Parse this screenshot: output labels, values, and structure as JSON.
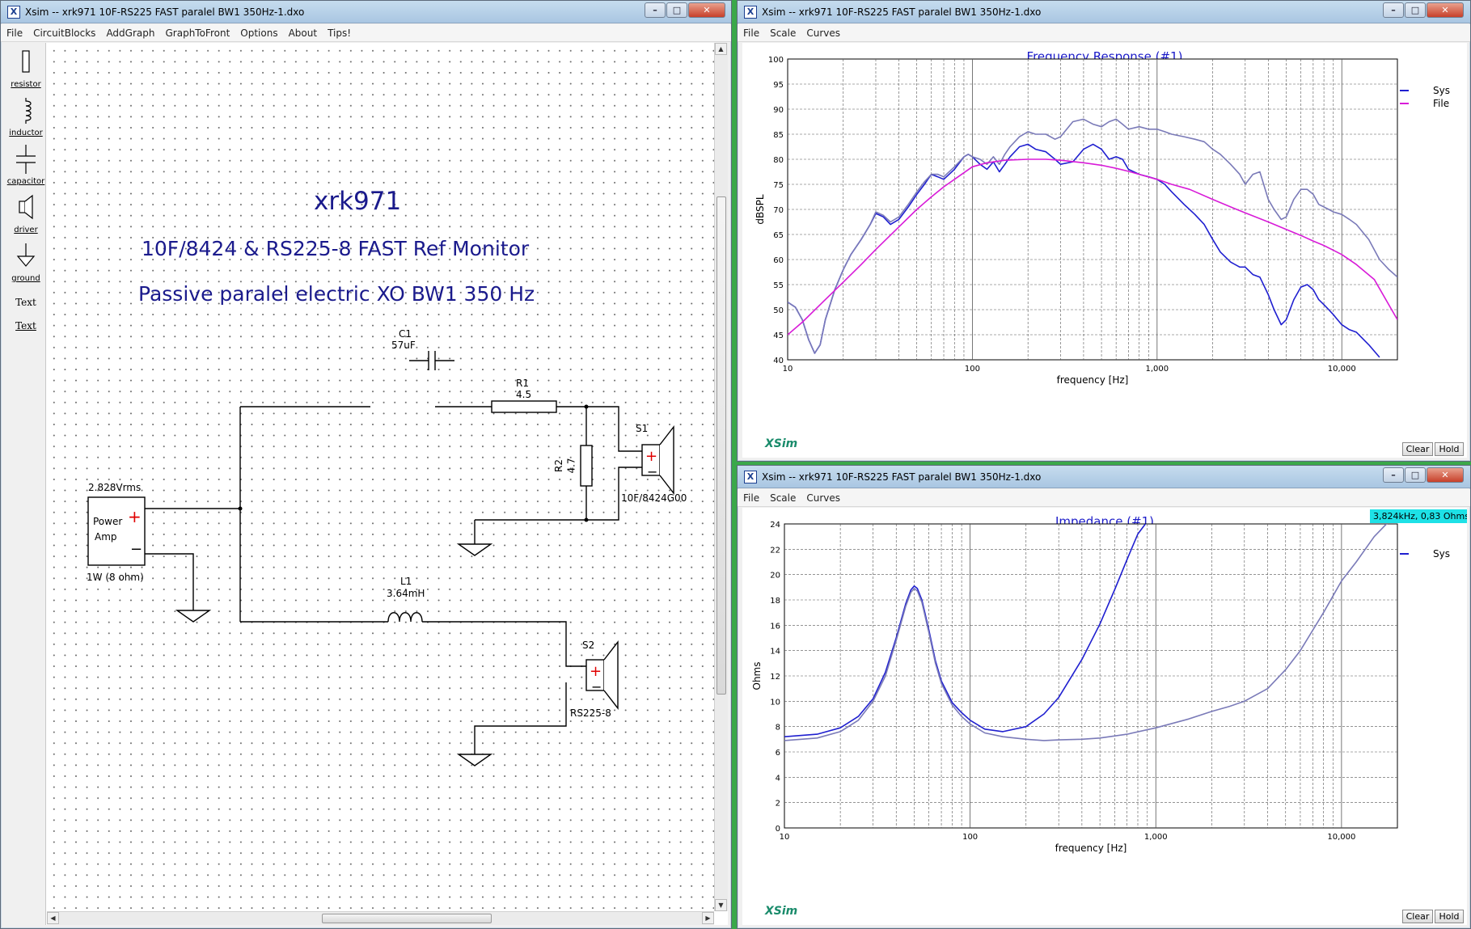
{
  "colors": {
    "desktop": "#3aa84a",
    "sys": "#1f1fd0",
    "sys_alt": "#7a7ab8",
    "file": "#d81bd8",
    "title_blue": "#1a1ac8",
    "readout_bg": "#1ee1e6"
  },
  "schematic_window": {
    "title": "Xsim -- xrk971 10F-RS225 FAST paralel BW1 350Hz-1.dxo",
    "menu": [
      "File",
      "CircuitBlocks",
      "AddGraph",
      "GraphToFront",
      "Options",
      "About",
      "Tips!"
    ],
    "tools": [
      {
        "label": "resistor",
        "icon": "resistor-icon"
      },
      {
        "label": "inductor",
        "icon": "inductor-icon"
      },
      {
        "label": "capacitor",
        "icon": "capacitor-icon"
      },
      {
        "label": "driver",
        "icon": "speaker-icon"
      },
      {
        "label": "ground",
        "icon": "ground-icon"
      },
      {
        "label": "Text",
        "icon": ""
      },
      {
        "label": "Text",
        "icon": ""
      }
    ],
    "heading": "xrk971",
    "subheading1": "10F/8424 & RS225-8 FAST Ref Monitor",
    "subheading2": "Passive paralel electric XO BW1 350 Hz",
    "amp": {
      "voltage": "2.828Vrms",
      "name_line1": "Power",
      "name_line2": "Amp",
      "power": "1W (8 ohm)"
    },
    "c1": {
      "name": "C1",
      "value": "57uF"
    },
    "r1": {
      "name": "R1",
      "value": "4.5"
    },
    "r2": {
      "name": "R2",
      "value": "4.7"
    },
    "l1": {
      "name": "L1",
      "value": "3.64mH"
    },
    "s1": {
      "name": "S1",
      "model": "10F/8424G00"
    },
    "s2": {
      "name": "S2",
      "model": "RS225-8"
    }
  },
  "freq_window": {
    "title": "Xsim -- xrk971 10F-RS225 FAST paralel BW1 350Hz-1.dxo",
    "menu": [
      "File",
      "Scale",
      "Curves"
    ],
    "logo": "XSim",
    "buttons": [
      "Clear",
      "Hold"
    ],
    "legend": [
      "Sys",
      "File"
    ]
  },
  "imp_window": {
    "title": "Xsim -- xrk971 10F-RS225 FAST paralel BW1 350Hz-1.dxo",
    "menu": [
      "File",
      "Scale",
      "Curves"
    ],
    "logo": "XSim",
    "readout": "3,824kHz, 0,83 Ohms",
    "buttons": [
      "Clear",
      "Hold"
    ],
    "legend": [
      "Sys"
    ]
  },
  "chart_data": [
    {
      "type": "line",
      "title": "Frequency Response (#1)",
      "xlabel": "frequency [Hz]",
      "ylabel": "dBSPL",
      "x_scale": "log",
      "xlim": [
        10,
        20000
      ],
      "ylim": [
        40,
        100
      ],
      "xticks": [
        {
          "v": 10,
          "t": "10"
        },
        {
          "v": 100,
          "t": "100"
        },
        {
          "v": 1000,
          "t": "1,000"
        },
        {
          "v": 10000,
          "t": "10,000"
        }
      ],
      "yticks": [
        40,
        45,
        50,
        55,
        60,
        65,
        70,
        75,
        80,
        85,
        90,
        95,
        100
      ],
      "grid": true,
      "legend_position": "top-right",
      "series": [
        {
          "name": "Sys",
          "color": "#1f1fd0",
          "x": [
            10,
            11,
            12,
            13,
            14,
            15,
            16,
            18,
            20,
            22,
            25,
            28,
            30,
            33,
            36,
            40,
            45,
            50,
            55,
            60,
            65,
            70,
            80,
            90,
            95,
            100,
            110,
            120,
            130,
            140,
            150,
            160,
            180,
            200,
            220,
            250,
            280,
            300,
            350,
            400,
            450,
            500,
            550,
            600,
            650,
            700,
            800,
            900,
            1000,
            1100,
            1200,
            1400,
            1600,
            1800,
            2000,
            2200,
            2500,
            2800,
            3000,
            3300,
            3600,
            4000,
            4300,
            4700,
            5000,
            5500,
            6000,
            6500,
            7000,
            7500,
            8000,
            8500,
            9000,
            10000,
            11000,
            12000,
            14000,
            16000
          ],
          "y": [
            51.5,
            50.5,
            48,
            44,
            41.3,
            43,
            48,
            54,
            58,
            61,
            64,
            67,
            69.2,
            68.5,
            67,
            68,
            70.5,
            73,
            75,
            77,
            76.5,
            76,
            78,
            80.5,
            81,
            80.5,
            79,
            78,
            79.5,
            77.5,
            79,
            80.5,
            82.5,
            83,
            82,
            81.5,
            80,
            79,
            79.5,
            82,
            83,
            82,
            80,
            80.5,
            80,
            78,
            77,
            76.5,
            76,
            75,
            73.5,
            71,
            69,
            67,
            64,
            61.5,
            59.5,
            58.5,
            58.5,
            57,
            56.5,
            53,
            50,
            47,
            48,
            52,
            54.5,
            55,
            54,
            52,
            51,
            50,
            49,
            47,
            46,
            45.5,
            43,
            40.5
          ]
        },
        {
          "name": "",
          "color": "#7a7ab8",
          "x": [
            10,
            11,
            12,
            13,
            14,
            15,
            16,
            18,
            20,
            22,
            25,
            28,
            30,
            33,
            36,
            40,
            45,
            50,
            55,
            60,
            65,
            70,
            80,
            90,
            95,
            100,
            110,
            120,
            130,
            140,
            150,
            160,
            180,
            200,
            220,
            250,
            280,
            300,
            350,
            400,
            450,
            500,
            550,
            600,
            650,
            700,
            800,
            900,
            1000,
            1100,
            1200,
            1400,
            1600,
            1800,
            2000,
            2200,
            2500,
            2800,
            3000,
            3300,
            3600,
            4000,
            4300,
            4700,
            5000,
            5500,
            6000,
            6500,
            7000,
            7500,
            8000,
            8500,
            9000,
            10000,
            11000,
            12000,
            14000,
            16000,
            18000,
            20000
          ],
          "y": [
            51.5,
            50.5,
            48,
            44,
            41.3,
            43,
            48,
            54,
            58,
            61,
            64,
            67,
            69.5,
            68.8,
            67.5,
            68.5,
            71,
            73.5,
            75.5,
            77,
            77,
            76.5,
            78.5,
            80.5,
            81,
            80.5,
            80,
            79,
            80.5,
            79,
            81,
            82.5,
            84.5,
            85.5,
            85,
            85,
            84,
            84.5,
            87.5,
            88,
            87,
            86.5,
            87.5,
            88,
            87,
            86,
            86.5,
            86,
            86,
            85.5,
            85,
            84.5,
            84,
            83.5,
            82,
            81,
            79,
            77,
            75,
            77,
            77.5,
            72,
            70,
            68,
            68.5,
            72,
            74,
            74,
            73,
            71,
            70.5,
            70,
            69.5,
            69,
            68,
            67,
            64,
            60,
            58,
            56.5
          ]
        },
        {
          "name": "File",
          "color": "#d81bd8",
          "x": [
            10,
            12,
            15,
            20,
            25,
            30,
            40,
            50,
            60,
            70,
            80,
            100,
            120,
            150,
            200,
            250,
            300,
            400,
            500,
            600,
            700,
            800,
            1000,
            1200,
            1500,
            2000,
            2500,
            3000,
            4000,
            5000,
            6000,
            7000,
            8000,
            10000,
            12000,
            15000,
            20000
          ],
          "y": [
            45,
            47.5,
            51,
            55.5,
            59,
            62,
            66.5,
            70,
            72.5,
            74.5,
            76,
            78.5,
            79.3,
            79.8,
            80,
            80,
            79.8,
            79.3,
            78.8,
            78.2,
            77.6,
            77,
            76,
            75,
            74,
            72,
            70.5,
            69.3,
            67.5,
            66,
            64.8,
            63.7,
            62.8,
            61,
            59,
            56,
            48
          ]
        }
      ]
    },
    {
      "type": "line",
      "title": "Impedance (#1)",
      "xlabel": "frequency [Hz]",
      "ylabel": "Ohms",
      "x_scale": "log",
      "xlim": [
        10,
        20000
      ],
      "ylim": [
        0,
        24
      ],
      "xticks": [
        {
          "v": 10,
          "t": "10"
        },
        {
          "v": 100,
          "t": "100"
        },
        {
          "v": 1000,
          "t": "1,000"
        },
        {
          "v": 10000,
          "t": "10,000"
        }
      ],
      "yticks": [
        0,
        2,
        4,
        6,
        8,
        10,
        12,
        14,
        16,
        18,
        20,
        22,
        24
      ],
      "grid": true,
      "legend_position": "top-right",
      "series": [
        {
          "name": "Sys",
          "color": "#1f1fd0",
          "x": [
            10,
            15,
            20,
            25,
            30,
            35,
            40,
            45,
            48,
            50,
            52,
            55,
            60,
            65,
            70,
            80,
            90,
            100,
            120,
            150,
            200,
            250,
            300,
            400,
            500,
            600,
            700,
            800,
            900
          ],
          "y": [
            7.2,
            7.4,
            7.9,
            8.8,
            10.2,
            12.3,
            15,
            17.7,
            18.8,
            19.1,
            18.9,
            18,
            15.6,
            13.2,
            11.6,
            9.9,
            9.1,
            8.5,
            7.8,
            7.6,
            8,
            9,
            10.3,
            13.3,
            16.1,
            18.8,
            21.2,
            23.2,
            24.2
          ]
        },
        {
          "name": "",
          "color": "#7a7ab8",
          "x": [
            10,
            15,
            20,
            25,
            30,
            35,
            40,
            45,
            48,
            50,
            52,
            55,
            60,
            65,
            70,
            80,
            90,
            100,
            120,
            150,
            200,
            250,
            300,
            400,
            500,
            700,
            1000,
            1500,
            2000,
            2500,
            3000,
            4000,
            5000,
            6000,
            8000,
            10000,
            12000,
            15000,
            18000
          ],
          "y": [
            6.9,
            7.1,
            7.6,
            8.5,
            10,
            12,
            14.8,
            17.5,
            18.6,
            18.9,
            18.7,
            17.8,
            15.4,
            13,
            11.4,
            9.7,
            8.8,
            8.2,
            7.5,
            7.2,
            7,
            6.9,
            6.95,
            7,
            7.1,
            7.4,
            7.9,
            8.6,
            9.2,
            9.6,
            10,
            11,
            12.5,
            14,
            17,
            19.5,
            21,
            23,
            24.2
          ]
        }
      ]
    }
  ]
}
